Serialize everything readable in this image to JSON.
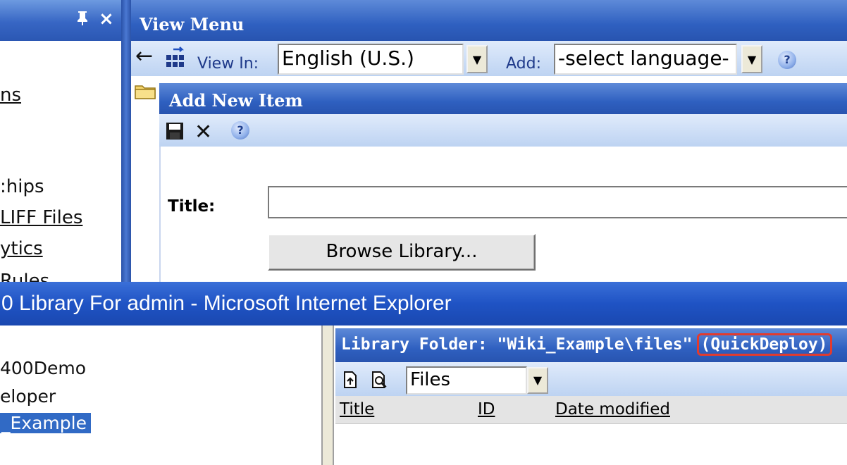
{
  "left_panel": {
    "pin_glyph": "$",
    "close_glyph": "×",
    "items": [
      {
        "label": "ns",
        "underline": true
      },
      {
        "label": ":hips",
        "underline": false
      },
      {
        "label": "LIFF Files",
        "underline": true
      },
      {
        "label": "ytics",
        "underline": true
      },
      {
        "label": "Rules",
        "underline": false
      }
    ]
  },
  "view_menu": {
    "title": "View Menu",
    "view_in_label": "View In:",
    "view_in_value": "English (U.S.)",
    "add_label": "Add:",
    "add_value": "-select language-"
  },
  "add_new_item": {
    "title": "Add New Item",
    "title_label": "Title:",
    "title_value": "",
    "browse_label": "Browse Library..."
  },
  "ie_window": {
    "title": "0 Library For admin - Microsoft Internet Explorer"
  },
  "tree": {
    "items": [
      {
        "label": "400Demo",
        "selected": false
      },
      {
        "label": "eloper",
        "selected": false
      },
      {
        "label": "_Example",
        "selected": true
      }
    ]
  },
  "library_folder": {
    "title": "Library Folder: \"Wiki_Example\\files\"",
    "badge": "(QuickDeploy)",
    "filter_value": "Files",
    "columns": [
      "Title",
      "ID",
      "Date modified"
    ]
  },
  "colors": {
    "title_blue": "#2f60c0",
    "toolbar_blue": "#bdd3f2",
    "highlight_red": "#e23b2e",
    "selection_blue": "#316ac5"
  }
}
